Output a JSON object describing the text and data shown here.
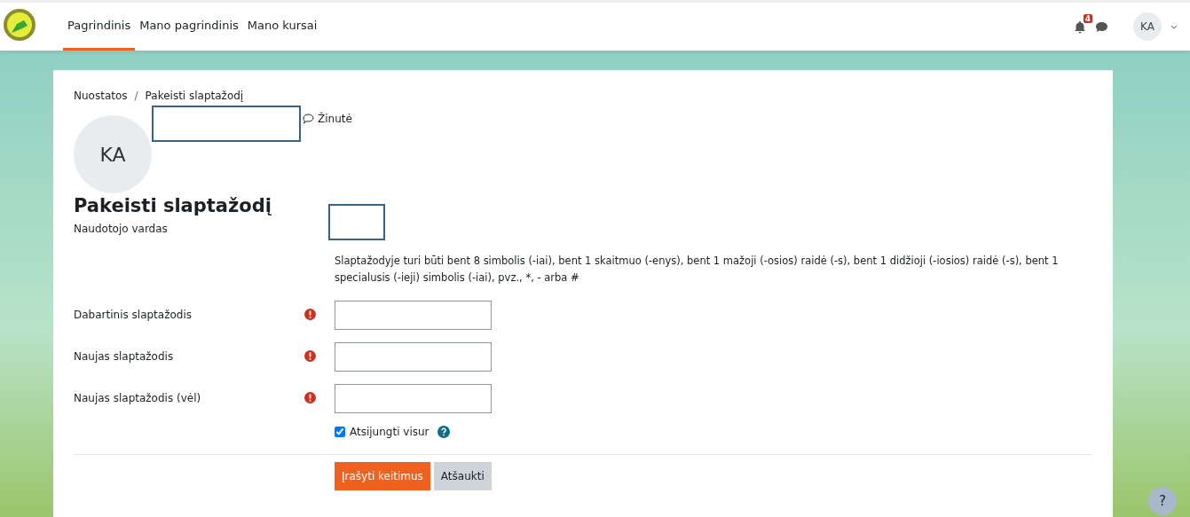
{
  "navbar": {
    "links": [
      {
        "label": "Pagrindinis",
        "selected": true
      },
      {
        "label": "Mano pagrindinis",
        "selected": false
      },
      {
        "label": "Mano kursai",
        "selected": false
      }
    ],
    "notification_count": "4",
    "user_initials": "KA"
  },
  "breadcrumb": [
    "Nuostatos",
    "/",
    "Pakeisti slaptažodį"
  ],
  "profile": {
    "initials": "KA",
    "message_link": "Žinutė"
  },
  "heading": "Pakeisti slaptažodį",
  "username_label": "Naudotojo vardas",
  "password_rules": "Slaptažodyje turi būti bent 8 simbolis (-iai), bent 1 skaitmuo (-enys), bent 1 mažoji (-osios) raidė (-s), bent 1 didžioji (-iosios) raidė (-s), bent 1 specialusis (-ieji) simbolis (-iai), pvz., *, - arba #",
  "fields": [
    {
      "label": "Dabartinis slaptažodis",
      "required": true
    },
    {
      "label": "Naujas slaptažodis",
      "required": true
    },
    {
      "label": "Naujas slaptažodis (vėl)",
      "required": true
    }
  ],
  "logout_everywhere": {
    "label": "Atsijungti visur",
    "checked": true
  },
  "buttons": [
    {
      "label": "Įrašyti keitimus",
      "kind": "primary"
    },
    {
      "label": "Atšaukti",
      "kind": "secondary"
    }
  ],
  "help_button": "?"
}
